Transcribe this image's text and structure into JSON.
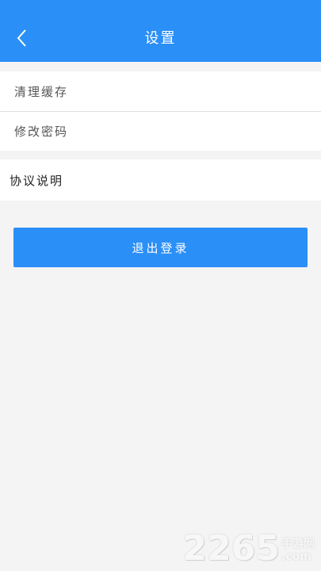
{
  "header": {
    "title": "设置",
    "back_icon": "chevron-left-icon"
  },
  "settings": {
    "items": [
      {
        "label": "清理缓存"
      },
      {
        "label": "修改密码"
      },
      {
        "label": "协议说明"
      }
    ]
  },
  "actions": {
    "logout_label": "退出登录"
  },
  "watermark": {
    "main": "2265",
    "top": "手游网",
    "bottom": ".com"
  },
  "colors": {
    "accent": "#2a8ff7",
    "background": "#f4f4f4"
  }
}
